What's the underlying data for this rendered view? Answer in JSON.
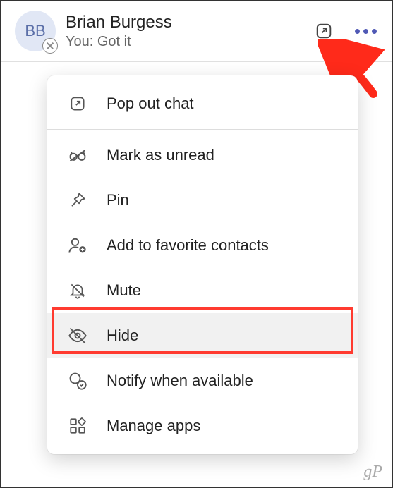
{
  "chat": {
    "avatar_initials": "BB",
    "name": "Brian Burgess",
    "preview": "You: Got it"
  },
  "menu": {
    "pop_out": "Pop out chat",
    "mark_unread": "Mark as unread",
    "pin": "Pin",
    "add_favorite": "Add to favorite contacts",
    "mute": "Mute",
    "hide": "Hide",
    "notify": "Notify when available",
    "manage_apps": "Manage apps"
  },
  "watermark": "gP"
}
